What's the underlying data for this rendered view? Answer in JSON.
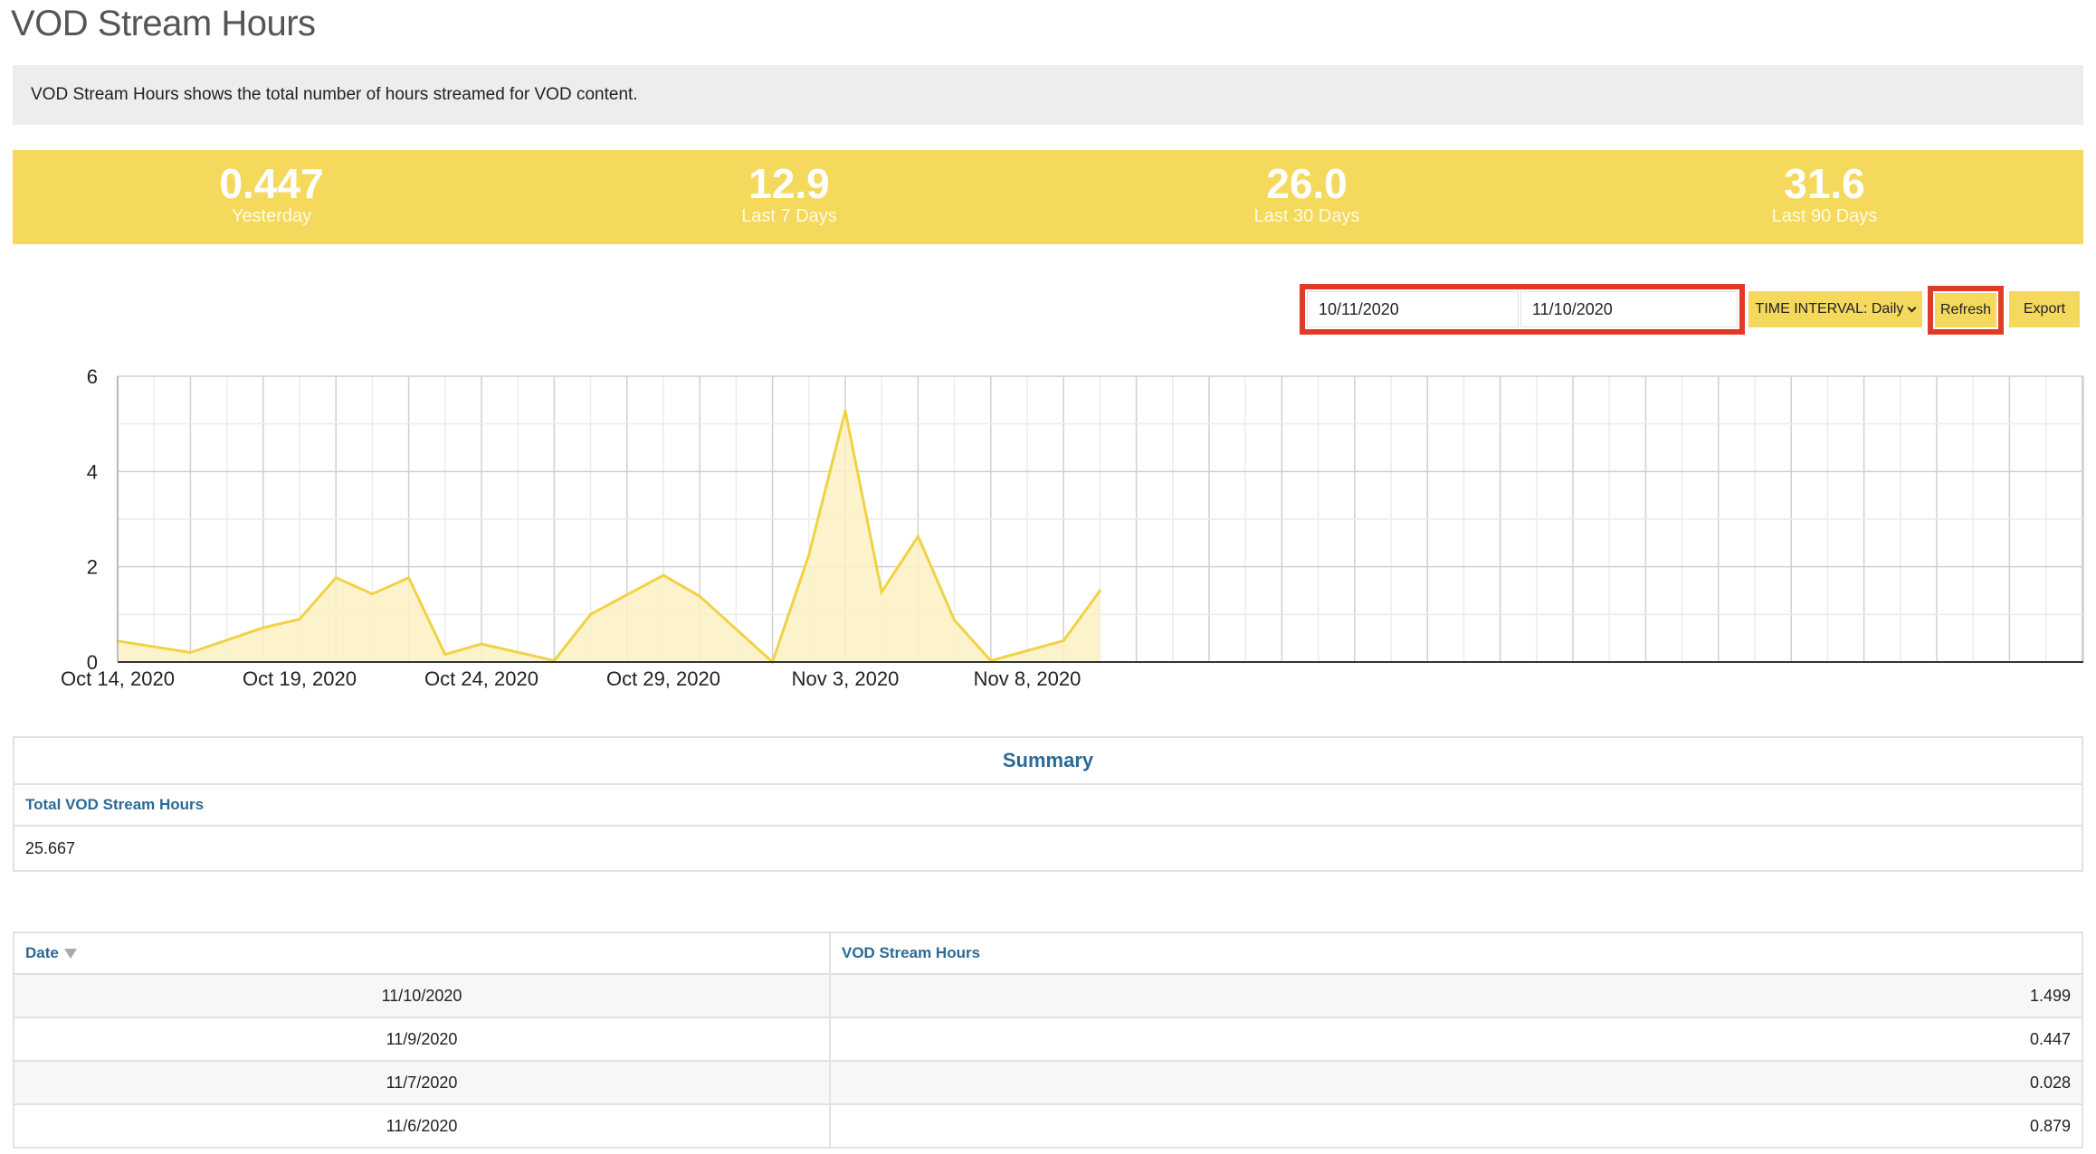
{
  "page": {
    "title": "VOD Stream Hours",
    "description": "VOD Stream Hours shows the total number of hours streamed for VOD content."
  },
  "kpis": [
    {
      "value": "0.447",
      "label": "Yesterday"
    },
    {
      "value": "12.9",
      "label": "Last 7 Days"
    },
    {
      "value": "26.0",
      "label": "Last 30 Days"
    },
    {
      "value": "31.6",
      "label": "Last 90 Days"
    }
  ],
  "controls": {
    "start_date": "10/11/2020",
    "end_date": "11/10/2020",
    "interval_label": "TIME INTERVAL: Daily",
    "refresh_label": "Refresh",
    "export_label": "Export"
  },
  "colors": {
    "accent": "#f5d95c",
    "highlight": "#e03a28",
    "link": "#2b6a95",
    "line": "#f0d245",
    "area": "#fbf1c4"
  },
  "chart_data": {
    "type": "area",
    "x": [
      "10/14/2020",
      "10/16/2020",
      "10/18/2020",
      "10/19/2020",
      "10/20/2020",
      "10/21/2020",
      "10/22/2020",
      "10/23/2020",
      "10/24/2020",
      "10/26/2020",
      "10/27/2020",
      "10/29/2020",
      "10/30/2020",
      "11/1/2020",
      "11/2/2020",
      "11/3/2020",
      "11/4/2020",
      "11/5/2020",
      "11/6/2020",
      "11/7/2020",
      "11/9/2020",
      "11/10/2020"
    ],
    "values": [
      0.44,
      0.2,
      0.72,
      0.9,
      1.77,
      1.43,
      1.77,
      0.16,
      0.38,
      0.03,
      1.0,
      1.82,
      1.38,
      0.0,
      2.25,
      5.27,
      1.47,
      2.64,
      0.879,
      0.028,
      0.447,
      1.499
    ],
    "xticks": [
      "Oct 14, 2020",
      "Oct 19, 2020",
      "Oct 24, 2020",
      "Oct 29, 2020",
      "Nov 3, 2020",
      "Nov 8, 2020"
    ],
    "yticks": [
      "0",
      "2",
      "4",
      "6"
    ],
    "ylim": [
      0,
      6
    ],
    "xrange": [
      "10/14/2020",
      "11/10/2020"
    ],
    "grid": true
  },
  "summary": {
    "title": "Summary",
    "column": "Total VOD Stream Hours",
    "value": "25.667"
  },
  "table": {
    "headers": [
      "Date",
      "VOD Stream Hours"
    ],
    "rows": [
      [
        "11/10/2020",
        "1.499"
      ],
      [
        "11/9/2020",
        "0.447"
      ],
      [
        "11/7/2020",
        "0.028"
      ],
      [
        "11/6/2020",
        "0.879"
      ]
    ]
  }
}
